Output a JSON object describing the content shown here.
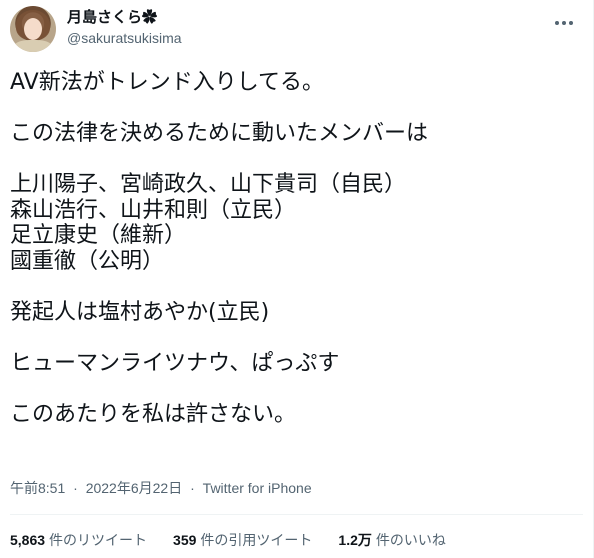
{
  "author": {
    "display_name": "月島さくら✿",
    "handle": "@sakuratsukisima"
  },
  "icons": {
    "more": "more-horizontal-icon",
    "avatar": "avatar-image"
  },
  "tweet": {
    "lines": [
      "AV新法がトレンド入りしてる。",
      "",
      "この法律を決めるために動いたメンバーは",
      "",
      "上川陽子、宮崎政久、山下貴司（自民）",
      "森山浩行、山井和則（立民）",
      "足立康史（維新）",
      "國重徹（公明）",
      "",
      "発起人は塩村あやか(立民)",
      "",
      "ヒューマンライツナウ、ぱっぷす",
      "",
      "このあたりを私は許さない。"
    ]
  },
  "meta": {
    "time": "午前8:51",
    "date": "2022年6月22日",
    "separator": "·",
    "source": "Twitter for iPhone"
  },
  "stats": {
    "retweets": {
      "count": "5,863",
      "label": "件のリツイート"
    },
    "quotes": {
      "count": "359",
      "label": "件の引用ツイート"
    },
    "likes": {
      "count": "1.2万",
      "label": "件のいいね"
    }
  },
  "colors": {
    "text": "#0f1419",
    "secondary": "#536471",
    "divider": "#eff3f4"
  }
}
